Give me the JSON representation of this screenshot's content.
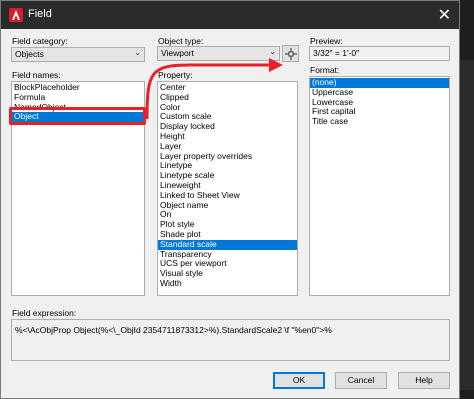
{
  "window": {
    "title": "Field"
  },
  "field_category": {
    "label": "Field category:",
    "value": "Objects"
  },
  "field_names": {
    "label": "Field names:",
    "items": [
      "BlockPlaceholder",
      "Formula",
      "NamedObject",
      "Object"
    ],
    "selected": "Object"
  },
  "object_type": {
    "label": "Object type:",
    "value": "Viewport"
  },
  "property": {
    "label": "Property:",
    "items": [
      "Center",
      "Clipped",
      "Color",
      "Custom scale",
      "Display locked",
      "Height",
      "Layer",
      "Layer property overrides",
      "Linetype",
      "Linetype scale",
      "Lineweight",
      "Linked to Sheet View",
      "Object name",
      "On",
      "Plot style",
      "Shade plot",
      "Standard scale",
      "Transparency",
      "UCS per viewport",
      "Visual style",
      "Width"
    ],
    "selected": "Standard scale"
  },
  "preview": {
    "label": "Preview:",
    "value": "3/32\" = 1'-0\""
  },
  "format": {
    "label": "Format:",
    "items": [
      "(none)",
      "Uppercase",
      "Lowercase",
      "First capital",
      "Title case"
    ],
    "selected": "(none)"
  },
  "expression": {
    "label": "Field expression:",
    "value": "%<\\AcObjProp Object(%<\\_ObjId 2354711873312>%).StandardScale2 \\f \"%en0\">%"
  },
  "buttons": {
    "ok": "OK",
    "cancel": "Cancel",
    "help": "Help"
  },
  "colors": {
    "accent": "#0078d7",
    "annotation": "#e8202a",
    "titlebar": "#2b2b2b"
  },
  "icons": {
    "app": "autocad-logo-icon",
    "close": "close-icon",
    "pick": "pick-object-icon"
  }
}
